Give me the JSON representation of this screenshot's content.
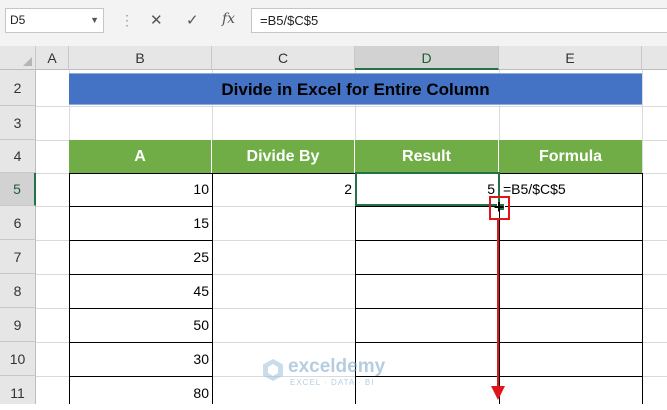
{
  "formula_bar": {
    "name_box": "D5",
    "cancel_icon": "✕",
    "enter_icon": "✓",
    "fx_label": "fx",
    "formula": "=B5/$C$5"
  },
  "columns": [
    "A",
    "B",
    "C",
    "D",
    "E"
  ],
  "rows": [
    "2",
    "3",
    "4",
    "5",
    "6",
    "7",
    "8",
    "9",
    "10",
    "11"
  ],
  "title": "Divide in Excel for Entire Column",
  "table": {
    "headers": [
      "A",
      "Divide By",
      "Result",
      "Formula"
    ],
    "a_values": [
      "10",
      "15",
      "25",
      "45",
      "50",
      "30",
      "80"
    ],
    "divisor": "2",
    "result": "5",
    "formula_text": "=B5/$C$5"
  },
  "watermark": {
    "name": "exceldemy",
    "tagline": "EXCEL · DATA · BI"
  },
  "colors": {
    "title_bg": "#4472c4",
    "header_bg": "#70ad47",
    "selection": "#217346",
    "annotation": "#e0141b"
  },
  "icons": {
    "autofill_cursor": "crosshair-icon",
    "drag_arrow": "arrow-down-icon"
  }
}
